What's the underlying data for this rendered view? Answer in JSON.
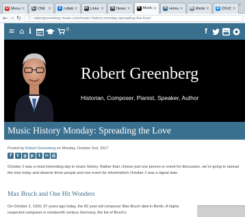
{
  "browser": {
    "tabs": [
      {
        "title": "Menu",
        "color": "#d32f2f",
        "glyph": "O"
      },
      {
        "title": "CNE",
        "color": "#5f6f7a",
        "glyph": "C"
      },
      {
        "title": "collabor",
        "color": "#1976d2",
        "glyph": "c"
      },
      {
        "title": "Linke",
        "color": "#333333",
        "glyph": "in"
      },
      {
        "title": "News",
        "color": "#444444",
        "glyph": "N"
      },
      {
        "title": "Music H",
        "color": "#000000",
        "glyph": "R"
      },
      {
        "title": "Home",
        "color": "#3a6f8e",
        "glyph": "H"
      },
      {
        "title": "Webin",
        "color": "#7a8b99",
        "glyph": "W"
      },
      {
        "title": "DSVD",
        "color": "#1e88e5",
        "glyph": "D"
      }
    ],
    "active_tab_index": 5,
    "tab_close_glyph": "×",
    "minimize_glyph": "—",
    "url": "robertgreenberg music.com/music-history-monday-spreading-the-love/"
  },
  "site": {
    "accent": "#3a6f8e",
    "cart_count": "0",
    "nav_icons": [
      "menu-icon",
      "home-icon",
      "info-icon",
      "calendar-icon",
      "graduation-cap-icon",
      "cart-icon"
    ],
    "social_icons": [
      "facebook-icon",
      "twitter-icon",
      "youtube-icon",
      "social-icon"
    ],
    "name": "Robert Greenberg",
    "tagline": "Historian, Composer, Pianist, Speaker, Author"
  },
  "post": {
    "title": "Music History Monday: Spreading the Love",
    "meta_prefix": "Posted by ",
    "author": "Robert Greenberg",
    "meta_suffix": " on Monday, October 2nd, 2017",
    "share_icons": [
      "f",
      "t",
      "g",
      "p",
      "t",
      "✉",
      "⎙"
    ],
    "intro": "October 2 was a most interesting day in music history. Rather than choose just one person or event for discussion, we’re going to spread the love today and observe three people and one event for whom/which October 2 was a signal date.",
    "section_heading": "Max Bruch and One Hit Wonders",
    "body": "On October 2, 1920, 97 years ago today, the 82 year-old composer Max Bruch died in Berlin. A highly respected composer in nineteenth century Germany, the list of Bruch’s"
  }
}
